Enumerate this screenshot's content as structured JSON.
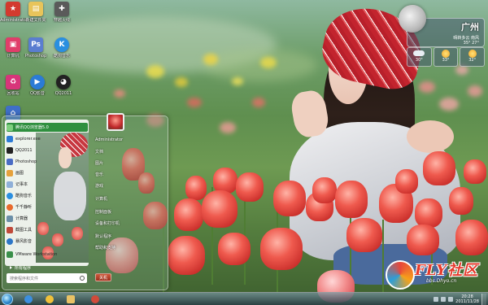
{
  "desktop_icons": [
    {
      "label": "Administrator",
      "icon": "folder-user-icon",
      "color": "#d33a2e"
    },
    {
      "label": "新建文件夹",
      "icon": "folder-icon",
      "color": "#e8c45a"
    },
    {
      "label": "穿越火线",
      "icon": "cf-game-icon",
      "color": "#5a5a5a"
    },
    {
      "label": "计算机",
      "icon": "computer-icon",
      "color": "#e03d6a"
    },
    {
      "label": "Photoshop",
      "icon": "photoshop-icon",
      "color": "#5a7dd0"
    },
    {
      "label": "酷狗音乐",
      "icon": "kugou-icon",
      "color": "#2a8fe0"
    },
    {
      "label": "回收站",
      "icon": "recycle-bin-icon",
      "color": "#d8357a"
    },
    {
      "label": "QQ影音",
      "icon": "qqplayer-icon",
      "color": "#2b7bd6"
    },
    {
      "label": "QQ2011",
      "icon": "qq-icon",
      "color": "#222222"
    },
    {
      "label": "网络",
      "icon": "network-icon",
      "color": "#3f6fc7"
    }
  ],
  "weather": {
    "city": "广州",
    "desc": "晴转多云 南风",
    "sub": "35°  27°",
    "days": [
      {
        "label": "30°",
        "icon": "cloud"
      },
      {
        "label": "33°",
        "icon": "sun"
      },
      {
        "label": "32°",
        "icon": "sun"
      }
    ]
  },
  "start_menu": {
    "left_items": [
      {
        "label": "腾讯QQ浏览器5.0",
        "color": "#ffffff",
        "highlight": true
      },
      {
        "label": "explorer.exe",
        "color": "#2c7bd6"
      },
      {
        "label": "QQ2011",
        "color": "#222222"
      },
      {
        "label": "Photoshop",
        "color": "#4a6cc4"
      },
      {
        "label": "画图",
        "color": "#e6a23c"
      },
      {
        "label": "记事本",
        "color": "#8fb0d8"
      },
      {
        "label": "酷狗音乐",
        "color": "#2a8fe0"
      },
      {
        "label": "千千静听",
        "color": "#e86a2c"
      },
      {
        "label": "计算器",
        "color": "#6b8fa8"
      },
      {
        "label": "截图工具",
        "color": "#c04a3a"
      },
      {
        "label": "暴风影音",
        "color": "#2d76c7"
      },
      {
        "label": "VMware Workstation",
        "color": "#3a8f4a"
      }
    ],
    "all_programs": "所有程序",
    "search_placeholder": "搜索程序和文件",
    "right_items": [
      "Administrator",
      "文档",
      "图片",
      "音乐",
      "游戏",
      "计算机",
      "控制面板",
      "设备和打印机",
      "默认程序",
      "帮助和支持"
    ],
    "shutdown_label": "关机"
  },
  "logo": {
    "brand": "FLY社区",
    "url": "bbs.Dhyo.cn"
  },
  "taskbar": {
    "buttons": [
      {
        "name": "ie",
        "color": "#3c8fe0"
      },
      {
        "name": "qq",
        "color": "#f2c13a"
      },
      {
        "name": "explorer",
        "color": "#e9c266"
      },
      {
        "name": "player",
        "color": "#d04a3a"
      }
    ],
    "time": "20:28",
    "date": "2011/11/28"
  }
}
